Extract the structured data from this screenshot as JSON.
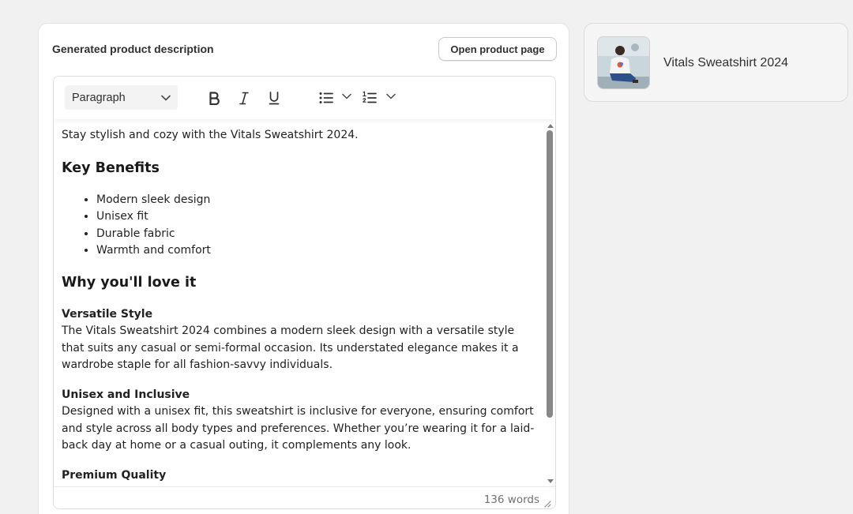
{
  "card": {
    "title": "Generated product description",
    "open_button_label": "Open product page"
  },
  "toolbar": {
    "block_format": "Paragraph",
    "buttons": [
      "bold-icon",
      "italic-icon",
      "underline-icon",
      "bullet-list-icon",
      "numbered-list-icon"
    ]
  },
  "description": {
    "intro": "Stay stylish and cozy with the Vitals Sweatshirt 2024.",
    "heading_benefits": "Key Benefits",
    "benefits": [
      "Modern sleek design",
      "Unisex fit",
      "Durable fabric",
      "Warmth and comfort"
    ],
    "heading_love": "Why you'll love it",
    "sections": [
      {
        "title": "Versatile Style",
        "body": "The Vitals Sweatshirt 2024 combines a modern sleek design with a versatile style that suits any casual or semi-formal occasion. Its understated elegance makes it a wardrobe staple for all fashion-savvy individuals."
      },
      {
        "title": "Unisex and Inclusive",
        "body": "Designed with a unisex fit, this sweatshirt is inclusive for everyone, ensuring comfort and style across all body types and preferences. Whether you’re wearing it for a laid-back day at home or a casual outing, it complements any look."
      },
      {
        "title": "Premium Quality",
        "body": ""
      }
    ]
  },
  "footer": {
    "word_count": "136 words"
  },
  "product": {
    "name": "Vitals Sweatshirt 2024",
    "image_icon": "product-thumbnail"
  },
  "colors": {
    "background": "#f1f1f1",
    "card": "#ffffff",
    "scrollbar_thumb": "#888888",
    "muted_text": "#707070"
  }
}
